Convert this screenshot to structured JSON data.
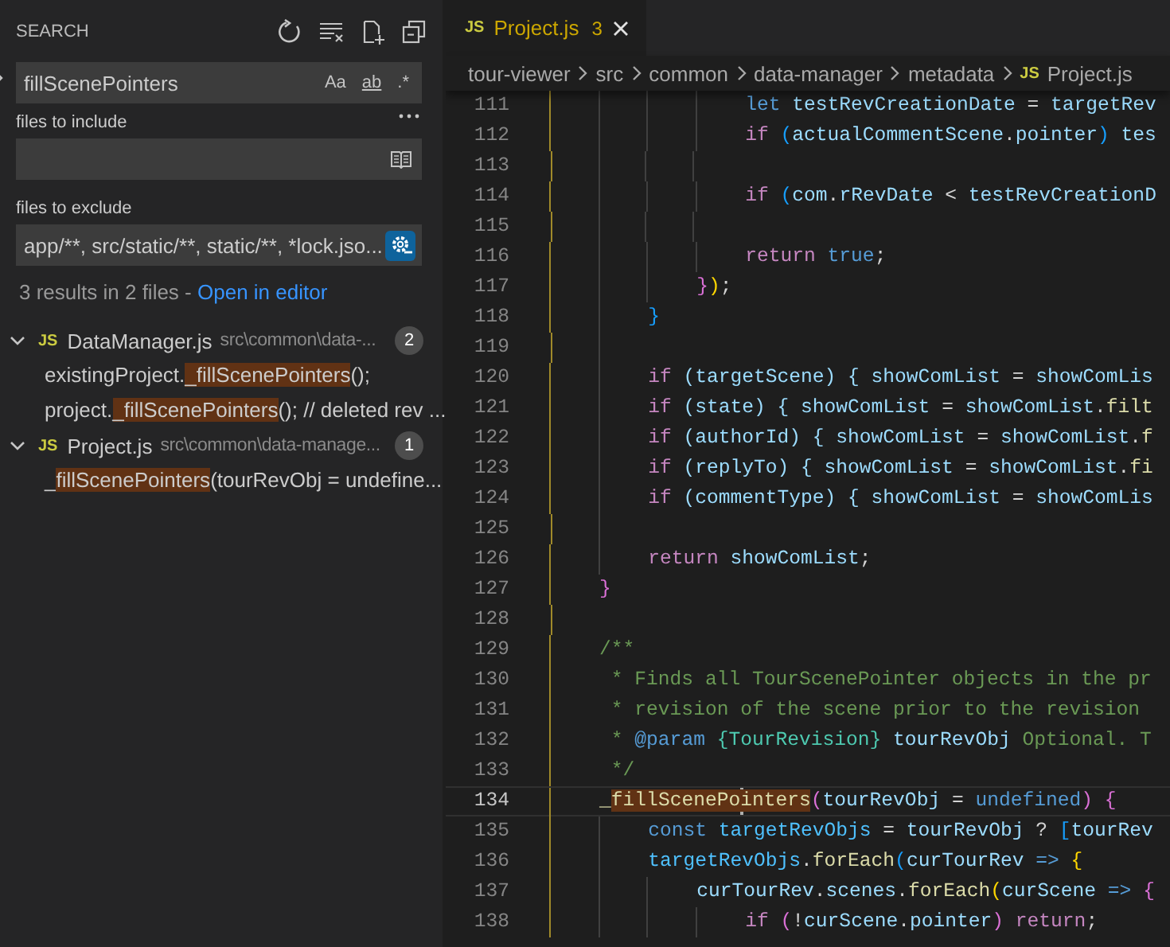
{
  "sidebar": {
    "title": "SEARCH",
    "replace_expanded": false,
    "search_field": {
      "value": "fillScenePointers",
      "toggles": [
        {
          "label": "Aa",
          "kind": "case",
          "on": false
        },
        {
          "label": "ab",
          "kind": "word",
          "on": false
        },
        {
          "label": ".*",
          "kind": "regex",
          "on": false
        }
      ]
    },
    "include": {
      "label": "files to include",
      "open_editors_only": false
    },
    "exclude": {
      "label": "files to exclude",
      "value": "app/**, src/static/**, static/**, *lock.jso...",
      "use_exclude_settings": true
    },
    "summary": {
      "text": "3 results in 2 files - ",
      "link": "Open in editor"
    },
    "results": [
      {
        "icon": "JS",
        "file": "DataManager.js",
        "path": "src\\common\\data-...",
        "count": "2",
        "expanded": true,
        "matches": [
          {
            "before": "existingProject.",
            "match": "_fillScenePointers",
            "after": "();"
          },
          {
            "before": "project.",
            "match": "_fillScenePointers",
            "after": "(); // deleted rev ..."
          }
        ]
      },
      {
        "icon": "JS",
        "file": "Project.js",
        "path": "src\\common\\data-manage...",
        "count": "1",
        "expanded": true,
        "matches": [
          {
            "before": "_",
            "match": "fillScenePointers",
            "after": "(tourRevObj = undefine..."
          }
        ]
      }
    ]
  },
  "editor": {
    "tabs": [
      {
        "icon": "JS",
        "label": "Project.js",
        "problems": "3",
        "selected": true
      }
    ],
    "breadcrumb": [
      {
        "label": "tour-viewer",
        "kind": "folder"
      },
      {
        "label": "src",
        "kind": "folder"
      },
      {
        "label": "common",
        "kind": "folder"
      },
      {
        "label": "data-manager",
        "kind": "folder"
      },
      {
        "label": "metadata",
        "kind": "folder"
      },
      {
        "label": "Project.js",
        "kind": "file",
        "icon": "JS"
      }
    ],
    "lines": [
      {
        "number": "111",
        "current": false,
        "tokens": [
          {
            "text": "                let",
            "kind": "decl"
          },
          {
            "text": " testRevCreationDate",
            "kind": "var"
          },
          {
            "text": " = ",
            "kind": "op"
          },
          {
            "text": "targetRev",
            "kind": "var"
          }
        ]
      },
      {
        "number": "112",
        "current": false,
        "tokens": [
          {
            "text": "                if",
            "kind": "kw"
          },
          {
            "text": " (",
            "kind": "b3"
          },
          {
            "text": "actualCommentScene",
            "kind": "var"
          },
          {
            "text": ".",
            "kind": "op"
          },
          {
            "text": "pointer",
            "kind": "var"
          },
          {
            "text": ")",
            "kind": "b3"
          },
          {
            "text": " tes",
            "kind": "var"
          }
        ]
      },
      {
        "number": "113",
        "current": false
      },
      {
        "number": "114",
        "current": false,
        "tokens": [
          {
            "text": "                if",
            "kind": "kw"
          },
          {
            "text": " (",
            "kind": "b3"
          },
          {
            "text": "com",
            "kind": "var"
          },
          {
            "text": ".",
            "kind": "op"
          },
          {
            "text": "rRevDate",
            "kind": "var"
          },
          {
            "text": " < ",
            "kind": "op"
          },
          {
            "text": "testRevCreationD",
            "kind": "var"
          }
        ]
      },
      {
        "number": "115",
        "current": false
      },
      {
        "number": "116",
        "current": false,
        "tokens": [
          {
            "text": "                return",
            "kind": "kw"
          },
          {
            "text": " true",
            "kind": "decl"
          },
          {
            "text": ";",
            "kind": "op"
          }
        ]
      },
      {
        "number": "117",
        "current": false,
        "tokens": [
          {
            "text": "            }",
            "kind": "b2"
          },
          {
            "text": ")",
            "kind": "b1"
          },
          {
            "text": ";",
            "kind": "op"
          }
        ]
      },
      {
        "number": "118",
        "current": false,
        "tokens": [
          {
            "text": "        }",
            "kind": "b3"
          }
        ]
      },
      {
        "number": "119",
        "current": false
      },
      {
        "number": "120",
        "current": false,
        "tokens": [
          {
            "text": "        if",
            "kind": "kw"
          },
          {
            "text": " (targetScene) { showComList",
            "kind": "var"
          },
          {
            "text": " = ",
            "kind": "op"
          },
          {
            "text": "showComLis",
            "kind": "var"
          }
        ]
      },
      {
        "number": "121",
        "current": false,
        "tokens": [
          {
            "text": "        if",
            "kind": "kw"
          },
          {
            "text": " (state) { showComList",
            "kind": "var"
          },
          {
            "text": " = ",
            "kind": "op"
          },
          {
            "text": "showComList",
            "kind": "var"
          },
          {
            "text": ".",
            "kind": "op"
          },
          {
            "text": "filt",
            "kind": "fn"
          }
        ]
      },
      {
        "number": "122",
        "current": false,
        "tokens": [
          {
            "text": "        if",
            "kind": "kw"
          },
          {
            "text": " (authorId) { showComList",
            "kind": "var"
          },
          {
            "text": " = ",
            "kind": "op"
          },
          {
            "text": "showComList",
            "kind": "var"
          },
          {
            "text": ".",
            "kind": "op"
          },
          {
            "text": "f",
            "kind": "fn"
          }
        ]
      },
      {
        "number": "123",
        "current": false,
        "tokens": [
          {
            "text": "        if",
            "kind": "kw"
          },
          {
            "text": " (replyTo) { showComList",
            "kind": "var"
          },
          {
            "text": " = ",
            "kind": "op"
          },
          {
            "text": "showComList",
            "kind": "var"
          },
          {
            "text": ".",
            "kind": "op"
          },
          {
            "text": "fi",
            "kind": "fn"
          }
        ]
      },
      {
        "number": "124",
        "current": false,
        "tokens": [
          {
            "text": "        if",
            "kind": "kw"
          },
          {
            "text": " (commentType) { showComList",
            "kind": "var"
          },
          {
            "text": " = ",
            "kind": "op"
          },
          {
            "text": "showComLis",
            "kind": "var"
          }
        ]
      },
      {
        "number": "125",
        "current": false
      },
      {
        "number": "126",
        "current": false,
        "tokens": [
          {
            "text": "        return",
            "kind": "kw"
          },
          {
            "text": " showComList",
            "kind": "var"
          },
          {
            "text": ";",
            "kind": "op"
          }
        ]
      },
      {
        "number": "127",
        "current": false,
        "tokens": [
          {
            "text": "    }",
            "kind": "b2"
          }
        ]
      },
      {
        "number": "128",
        "current": false
      },
      {
        "number": "129",
        "current": false,
        "tokens": [
          {
            "text": "    /**",
            "kind": "cmt"
          }
        ]
      },
      {
        "number": "130",
        "current": false,
        "tokens": [
          {
            "text": "     * Finds all TourScenePointer objects in the pr",
            "kind": "cmt"
          }
        ]
      },
      {
        "number": "131",
        "current": false,
        "tokens": [
          {
            "text": "     * revision of the scene prior to the revision",
            "kind": "cmt"
          }
        ]
      },
      {
        "number": "132",
        "current": false,
        "tokens": [
          {
            "text": "     * ",
            "kind": "cmt"
          },
          {
            "text": "@param",
            "kind": "decl"
          },
          {
            "text": " {TourRevision}",
            "kind": "type"
          },
          {
            "text": " tourRevObj",
            "kind": "var"
          },
          {
            "text": " Optional. T",
            "kind": "cmt"
          }
        ]
      },
      {
        "number": "133",
        "current": false,
        "tokens": [
          {
            "text": "     */",
            "kind": "cmt"
          }
        ]
      },
      {
        "number": "134",
        "current": true,
        "tokens": [
          {
            "text": "    _",
            "kind": "fn"
          },
          {
            "text": "fillScenePo",
            "kind": "fn",
            "match": true,
            "cursor": true
          },
          {
            "text": "inters",
            "kind": "fn",
            "match": true
          },
          {
            "text": "(",
            "kind": "b2"
          },
          {
            "text": "tourRevObj",
            "kind": "var"
          },
          {
            "text": " = ",
            "kind": "op"
          },
          {
            "text": "undefined",
            "kind": "decl"
          },
          {
            "text": ")",
            "kind": "b2"
          },
          {
            "text": " {",
            "kind": "b2"
          }
        ]
      },
      {
        "number": "135",
        "current": false,
        "tokens": [
          {
            "text": "        const",
            "kind": "decl"
          },
          {
            "text": " targetRevObjs",
            "kind": "const"
          },
          {
            "text": " = ",
            "kind": "op"
          },
          {
            "text": "tourRevObj",
            "kind": "var"
          },
          {
            "text": " ? ",
            "kind": "op"
          },
          {
            "text": "[",
            "kind": "b3"
          },
          {
            "text": "tourRev",
            "kind": "var"
          }
        ]
      },
      {
        "number": "136",
        "current": false,
        "tokens": [
          {
            "text": "        targetRevObjs",
            "kind": "const"
          },
          {
            "text": ".",
            "kind": "op"
          },
          {
            "text": "forEach",
            "kind": "fn"
          },
          {
            "text": "(",
            "kind": "b3"
          },
          {
            "text": "curTourRev",
            "kind": "var"
          },
          {
            "text": " => ",
            "kind": "decl"
          },
          {
            "text": "{",
            "kind": "b1"
          }
        ]
      },
      {
        "number": "137",
        "current": false,
        "tokens": [
          {
            "text": "            curTourRev",
            "kind": "var"
          },
          {
            "text": ".",
            "kind": "op"
          },
          {
            "text": "scenes",
            "kind": "var"
          },
          {
            "text": ".",
            "kind": "op"
          },
          {
            "text": "forEach",
            "kind": "fn"
          },
          {
            "text": "(",
            "kind": "b1"
          },
          {
            "text": "curScene",
            "kind": "var"
          },
          {
            "text": " => ",
            "kind": "decl"
          },
          {
            "text": "{",
            "kind": "b2"
          }
        ]
      },
      {
        "number": "138",
        "current": false,
        "tokens": [
          {
            "text": "                if",
            "kind": "kw"
          },
          {
            "text": " (",
            "kind": "b2"
          },
          {
            "text": "!",
            "kind": "op"
          },
          {
            "text": "curScene",
            "kind": "var"
          },
          {
            "text": ".",
            "kind": "op"
          },
          {
            "text": "pointer",
            "kind": "var"
          },
          {
            "text": ")",
            "kind": "b2"
          },
          {
            "text": " return",
            "kind": "kw"
          },
          {
            "text": ";",
            "kind": "op"
          }
        ]
      }
    ]
  }
}
